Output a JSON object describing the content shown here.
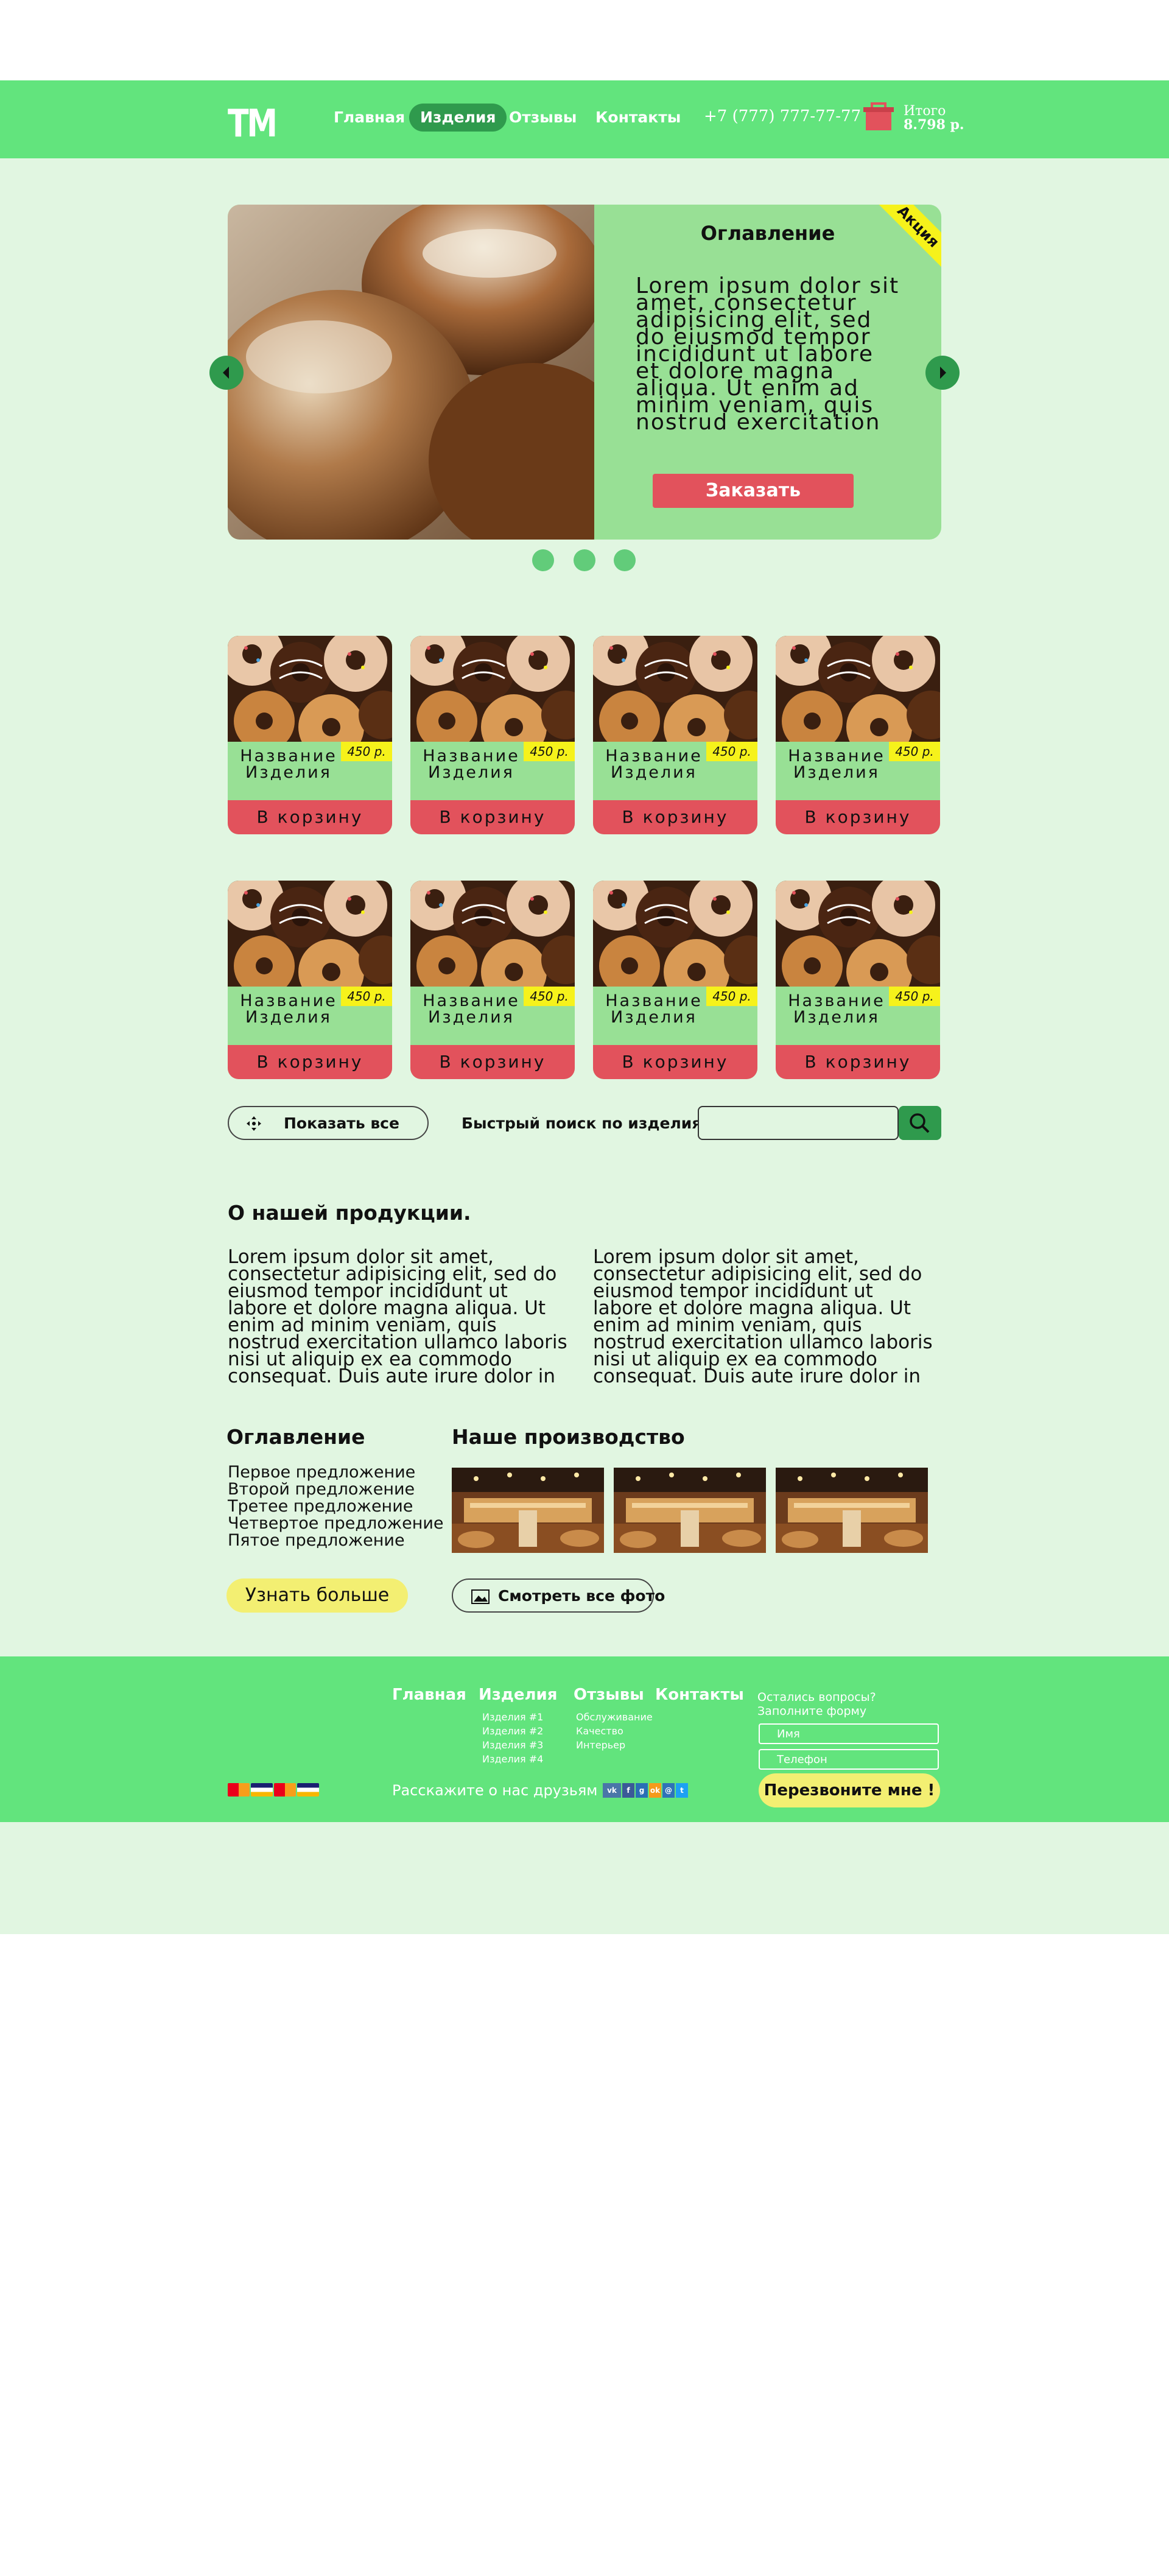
{
  "header": {
    "logo": "TM",
    "nav": [
      "Главная",
      "Изделия",
      "Отзывы",
      "Контакты"
    ],
    "active_nav": "Изделия",
    "phone": "+7 (777) 777-77-77",
    "total_label": "Итого",
    "total_value": "8.798 р."
  },
  "slider": {
    "title": "Оглавление",
    "text": "Lorem ipsum dolor sit amet, consectetur adipisicing elit, sed do eiusmod tempor incididunt ut labore et dolore magna aliqua. Ut enim ad minim veniam, quis nostrud exercitation",
    "order_button": "Заказать",
    "promo": "Акция",
    "dots": 3
  },
  "products": [
    {
      "name": "Название Изделия",
      "price": "450 р.",
      "cart": "В корзину"
    },
    {
      "name": "Название Изделия",
      "price": "450 р.",
      "cart": "В корзину"
    },
    {
      "name": "Название Изделия",
      "price": "450 р.",
      "cart": "В корзину"
    },
    {
      "name": "Название Изделия",
      "price": "450 р.",
      "cart": "В корзину"
    },
    {
      "name": "Название Изделия",
      "price": "450 р.",
      "cart": "В корзину"
    },
    {
      "name": "Название Изделия",
      "price": "450 р.",
      "cart": "В корзину"
    },
    {
      "name": "Название Изделия",
      "price": "450 р.",
      "cart": "В корзину"
    },
    {
      "name": "Название Изделия",
      "price": "450 р.",
      "cart": "В корзину"
    }
  ],
  "toolbar": {
    "show_all": "Показать все",
    "search_label": "Быстрый поиск по изделиям",
    "search_value": ""
  },
  "about": {
    "title": "О нашей продукции.",
    "col1": "Lorem ipsum dolor sit amet, consectetur adipisicing elit, sed do eiusmod tempor incididunt ut labore et dolore magna aliqua. Ut enim ad minim veniam, quis nostrud exercitation ullamco laboris nisi ut aliquip ex ea commodo consequat. Duis aute irure dolor in",
    "col2": "Lorem ipsum dolor sit amet, consectetur adipisicing elit, sed do eiusmod tempor incididunt ut labore et dolore magna aliqua. Ut enim ad minim veniam, quis nostrud exercitation ullamco laboris nisi ut aliquip ex ea commodo consequat. Duis aute irure dolor in"
  },
  "toc": {
    "title": "Оглавление",
    "items": [
      "Первое предложение",
      "Второй предложение",
      "Третее предложение",
      "Четвертое предложение",
      "Пятое предложение"
    ],
    "learn_more": "Узнать больше"
  },
  "production": {
    "title": "Наше производство",
    "all_photos": "Смотреть все фото"
  },
  "footer": {
    "nav": [
      "Главная",
      "Изделия",
      "Отзывы",
      "Контакты"
    ],
    "products_sub": [
      "Изделия #1",
      "Изделия #2",
      "Изделия #3",
      "Изделия #4"
    ],
    "reviews_sub": [
      "Обслуживание",
      "Качество",
      "Интерьер"
    ],
    "questions": [
      "Остались вопросы?",
      "Заполните форму"
    ],
    "name_placeholder": "Имя",
    "phone_placeholder": "Телефон",
    "callback": "Перезвоните мне !",
    "share": "Расскажите о нас друзьям",
    "social": [
      "vk-icon",
      "facebook-icon",
      "google-icon",
      "odnoklassniki-icon",
      "mailru-icon",
      "twitter-icon"
    ],
    "payment": [
      "mastercard-icon",
      "visa-icon",
      "mastercard-icon",
      "visa-icon"
    ]
  },
  "colors": {
    "header_green": "#62e47d",
    "page_bg": "#e1f6e1",
    "card_green": "#98e095",
    "accent_red": "#e2525c",
    "accent_yellow": "#f6f21b",
    "dark_green": "#2f9a4d"
  }
}
